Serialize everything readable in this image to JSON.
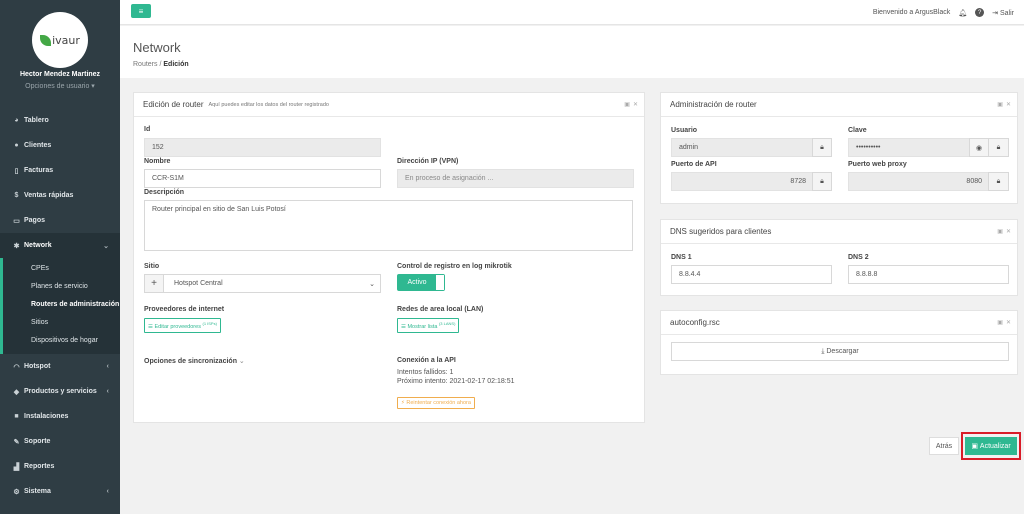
{
  "app": {
    "logo_text": "ivaur",
    "logo_initial": "L"
  },
  "user": {
    "name": "Hector Mendez Martinez",
    "options": "Opciones de usuario ▾"
  },
  "sidebar": {
    "items": [
      {
        "label": "Tablero",
        "icon": "dashboard-icon"
      },
      {
        "label": "Clientes",
        "icon": "users-icon"
      },
      {
        "label": "Facturas",
        "icon": "file-icon"
      },
      {
        "label": "Ventas rápidas",
        "icon": "dollar-icon"
      },
      {
        "label": "Pagos",
        "icon": "money-icon"
      },
      {
        "label": "Network",
        "icon": "gear-icon"
      },
      {
        "label": "Hotspot",
        "icon": "wifi-icon"
      },
      {
        "label": "Productos y servicios",
        "icon": "cube-icon"
      },
      {
        "label": "Instalaciones",
        "icon": "truck-icon"
      },
      {
        "label": "Soporte",
        "icon": "wrench-icon"
      },
      {
        "label": "Reportes",
        "icon": "chart-icon"
      },
      {
        "label": "Sistema",
        "icon": "cogs-icon"
      }
    ],
    "network_sub": [
      "CPEs",
      "Planes de servicio",
      "Routers de administración",
      "Sitios",
      "Dispositivos de hogar"
    ]
  },
  "topbar": {
    "welcome": "Bienvenido a ArgusBlack",
    "logout": "Salir"
  },
  "header": {
    "title": "Network",
    "crumb_root": "Routers",
    "crumb_sep": "/",
    "crumb_current": "Edición"
  },
  "edit_panel": {
    "title": "Edición de router",
    "subtitle": "Aquí puedes editar los datos del router registrado",
    "id_label": "Id",
    "id_value": "152",
    "name_label": "Nombre",
    "name_value": "CCR-S1M",
    "ip_label": "Dirección IP (VPN)",
    "ip_value": "En proceso de asignación ...",
    "desc_label": "Descripción",
    "desc_value": "Router principal en sitio de San Luis Potosí",
    "site_label": "Sitio",
    "site_value": "Hotspot Central",
    "log_label": "Control de registro en log mikrotik",
    "log_value": "Activo",
    "providers_label": "Proveedores de internet",
    "providers_btn": "Editar proveedores",
    "providers_count": "(1 ISPs)",
    "lan_label": "Redes de area local (LAN)",
    "lan_btn": "Mostrar lista",
    "lan_count": "(3 LANS)",
    "sync_label": "Opciones de sincronización",
    "api_label": "Conexión a la API",
    "api_failed": "Intentos fallidos: 1",
    "api_next": "Próximo intento: 2021-02-17 02:18:51",
    "api_retry": "Reintentar conexión ahora"
  },
  "admin_panel": {
    "title": "Administración de router",
    "user_label": "Usuario",
    "user_value": "admin",
    "pass_label": "Clave",
    "pass_value": "••••••••••",
    "api_port_label": "Puerto de API",
    "api_port_value": "8728",
    "proxy_label": "Puerto web proxy",
    "proxy_value": "8080"
  },
  "dns_panel": {
    "title": "DNS sugeridos para clientes",
    "dns1_label": "DNS 1",
    "dns1_value": "8.8.4.4",
    "dns2_label": "DNS 2",
    "dns2_value": "8.8.8.8"
  },
  "autoconfig_panel": {
    "title": "autoconfig.rsc",
    "download": "Descargar"
  },
  "actions": {
    "back": "Atrás",
    "update": "Actualizar"
  }
}
